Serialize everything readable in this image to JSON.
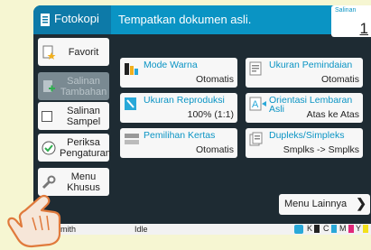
{
  "header": {
    "app_title": "Fotokopi",
    "instruction": "Tempatkan dokumen asli.",
    "copies_label": "Salinan",
    "copies_value": "1"
  },
  "sidebar": {
    "items": [
      {
        "label": "Favorit",
        "icon": "favorite-document-icon",
        "enabled": true
      },
      {
        "label": "Salinan Tambahan",
        "icon": "add-copy-icon",
        "enabled": false
      },
      {
        "label": "Salinan Sampel",
        "icon": "checkbox-icon",
        "enabled": true
      },
      {
        "label": "Periksa Pengaturan",
        "icon": "check-circle-icon",
        "enabled": true
      },
      {
        "label": "Menu Khusus",
        "icon": "wrench-icon",
        "enabled": true
      }
    ]
  },
  "tiles": [
    {
      "title": "Mode Warna",
      "value": "Otomatis",
      "icon": "color-mode-icon"
    },
    {
      "title": "Ukuran Pemindaian",
      "value": "Otomatis",
      "icon": "scan-size-icon"
    },
    {
      "title": "Ukuran Reproduksi",
      "value": "100% (1:1)",
      "icon": "reproduction-size-icon"
    },
    {
      "title": "Orientasi Lembaran Asli",
      "value": "Atas ke Atas",
      "icon": "orientation-icon"
    },
    {
      "title": "Pemilihan Kertas",
      "value": "Otomatis",
      "icon": "paper-tray-icon"
    },
    {
      "title": "Dupleks/Simpleks",
      "value": "Smplks -> Smplks",
      "icon": "duplex-icon"
    }
  ],
  "more_menu": {
    "label": "Menu Lainnya"
  },
  "status_bar": {
    "user": "Smith",
    "state": "Idle",
    "toners": [
      {
        "label": "K",
        "color": "#222222"
      },
      {
        "label": "C",
        "color": "#29a8d8"
      },
      {
        "label": "M",
        "color": "#e0287a"
      },
      {
        "label": "Y",
        "color": "#f2e01c"
      }
    ]
  },
  "colors": {
    "accent": "#0a94c4",
    "panel": "#1e2b33",
    "background": "#f6f6d2"
  }
}
